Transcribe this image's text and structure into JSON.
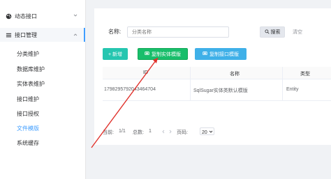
{
  "sidebar": {
    "items": [
      {
        "label": "动态接口",
        "icon": "palette-icon"
      },
      {
        "label": "接口管理",
        "icon": "menu-icon"
      }
    ],
    "subitems": [
      {
        "label": "分类维护"
      },
      {
        "label": "数据库维护"
      },
      {
        "label": "实体表维护"
      },
      {
        "label": "接口维护"
      },
      {
        "label": "接口授权"
      },
      {
        "label": "文件模版"
      },
      {
        "label": "系统缓存"
      }
    ],
    "active_sub": "文件模版",
    "accent": "#409eff"
  },
  "search": {
    "label": "名称:",
    "placeholder": "分类名称",
    "search_label": "搜索",
    "clear_label": "清空"
  },
  "toolbar": {
    "add_label": "+ 新增",
    "copy_entity_label": "复制实体模版",
    "copy_api_label": "复制接口模版"
  },
  "table": {
    "headers": [
      "ID",
      "名称",
      "类型"
    ],
    "rows": [
      [
        "1798295792043464704",
        "SqlSugar实体类默认模版",
        "Entity"
      ]
    ]
  },
  "pager": {
    "current_label": "当前:",
    "current_value": "1/1",
    "total_label": "总数:",
    "total_value": "1",
    "page_size_label": "页码:",
    "page_size_value": "20"
  },
  "colors": {
    "add": "#26c6b0",
    "copy_entity": "#19be6b",
    "copy_api": "#3fb0e8",
    "annotation_arrow": "#e0312b"
  }
}
